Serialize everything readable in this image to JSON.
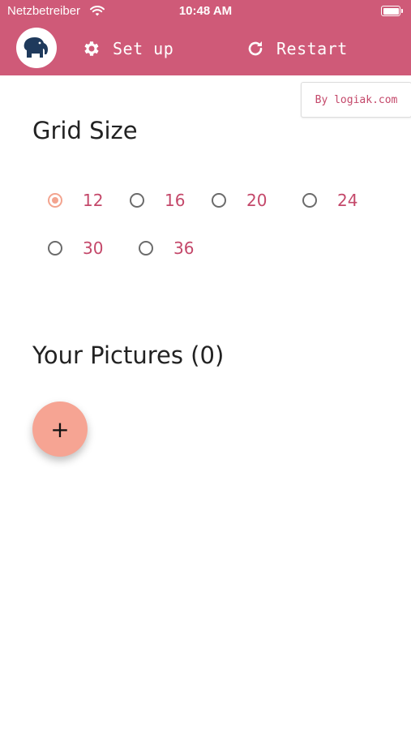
{
  "status_bar": {
    "carrier": "Netzbetreiber",
    "time": "10:48 AM"
  },
  "app_bar": {
    "setup_label": "Set up",
    "restart_label": "Restart",
    "setup_icon": "gear-icon",
    "restart_icon": "refresh-icon",
    "logo_icon": "elephant-icon"
  },
  "credit": "By logiak.com",
  "grid_size": {
    "title": "Grid Size",
    "options": [
      "12",
      "16",
      "20",
      "24",
      "30",
      "36"
    ],
    "selected": "12"
  },
  "pictures": {
    "title": "Your Pictures (0)",
    "add_label": "+"
  },
  "colors": {
    "brand": "#cf5a78",
    "accent": "#f3a48f",
    "option_text": "#c4486a"
  }
}
